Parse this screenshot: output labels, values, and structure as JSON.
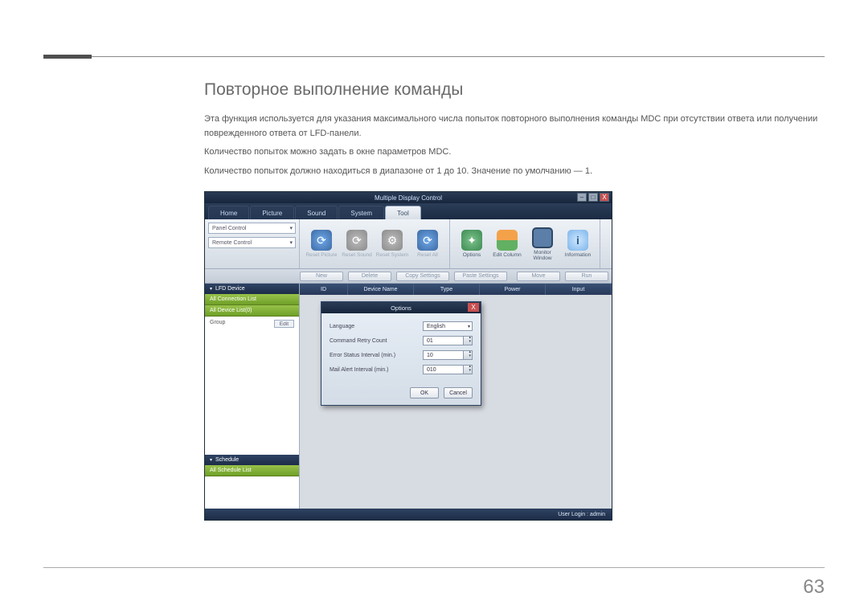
{
  "doc": {
    "section_title": "Повторное выполнение команды",
    "p1": "Эта функция используется для указания максимального числа попыток повторного выполнения команды MDC при отсутствии ответа или получении поврежденного ответа от LFD-панели.",
    "p2": "Количество попыток можно задать в окне параметров MDC.",
    "p3": "Количество попыток должно находиться в диапазоне от 1 до 10. Значение по умолчанию — 1.",
    "page_number": "63"
  },
  "app": {
    "window_title": "Multiple Display Control",
    "win_btns": {
      "min": "–",
      "max": "□",
      "close": "X"
    },
    "tabs": [
      "Home",
      "Picture",
      "Sound",
      "System",
      "Tool"
    ],
    "active_tab": "Tool",
    "ribbon_left": {
      "panel_control": "Panel Control",
      "remote_control": "Remote Control"
    },
    "ribbon_btns": {
      "reset_picture": "Reset Picture",
      "reset_sound": "Reset Sound",
      "reset_system": "Reset System",
      "reset_all": "Reset All",
      "options": "Options",
      "edit_column": "Edit Column",
      "monitor_window": "Monitor\nWindow",
      "information": "Information"
    },
    "action_btns": {
      "new": "New",
      "delete": "Delete",
      "copy_settings": "Copy Settings",
      "paste_settings": "Paste Settings",
      "move": "Move",
      "run": "Run"
    },
    "sidebar": {
      "lfd_head": "LFD Device",
      "all_conn": "All Connection List",
      "all_dev": "All Device List(0)",
      "group_label": "Group",
      "edit": "Edit",
      "schedule_head": "Schedule",
      "all_sched": "All Schedule List"
    },
    "columns": [
      "ID",
      "Device Name",
      "Type",
      "Power",
      "Input"
    ],
    "dialog": {
      "title": "Options",
      "close": "X",
      "rows": {
        "language": {
          "label": "Language",
          "value": "English"
        },
        "retry": {
          "label": "Command Retry Count",
          "value": "01"
        },
        "error_interval": {
          "label": "Error Status Interval (min.)",
          "value": "10"
        },
        "mail_interval": {
          "label": "Mail Alert Interval (min.)",
          "value": "010"
        }
      },
      "ok": "OK",
      "cancel": "Cancel"
    },
    "status": "User Login : admin"
  }
}
